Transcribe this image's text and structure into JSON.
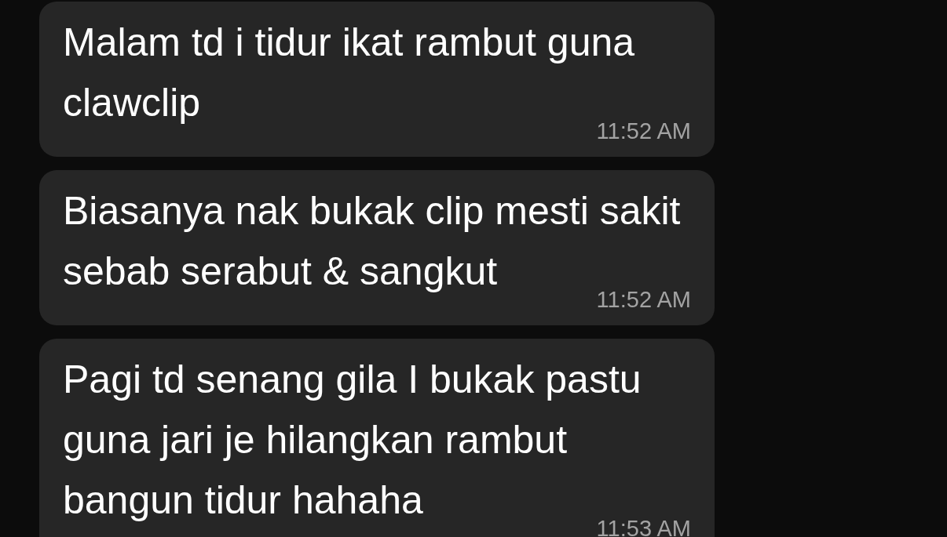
{
  "messages": [
    {
      "text": "Malam td i tidur ikat rambut guna clawclip",
      "time": "11:52 AM"
    },
    {
      "text": "Biasanya nak bukak clip mesti sakit sebab serabut & sangkut",
      "time": "11:52 AM"
    },
    {
      "text": "Pagi td senang gila I bukak pastu guna jari je hilangkan rambut bangun tidur hahaha",
      "time": "11:53 AM"
    }
  ]
}
